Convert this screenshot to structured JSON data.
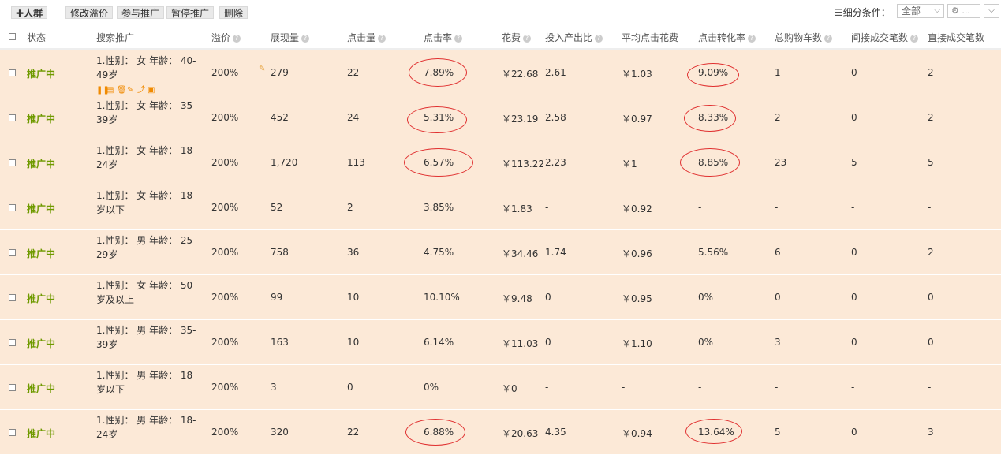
{
  "toolbar": {
    "add_label": "人群",
    "add_icon": "plus-icon",
    "buttons": [
      "修改溢价",
      "参与推广",
      "暂停推广",
      "删除"
    ],
    "filter_label": "细分条件：",
    "filter_value": "全部",
    "gear_text": "..."
  },
  "headers": {
    "status": "状态",
    "target": "搜索推广",
    "premium": "溢价",
    "impressions": "展现量",
    "clicks": "点击量",
    "ctr": "点击率",
    "cost": "花费",
    "roi": "投入产出比",
    "cpc": "平均点击花费",
    "cvr": "点击转化率",
    "cart": "总购物车数",
    "indirect": "间接成交笔数",
    "direct": "直接成交笔数"
  },
  "rows": [
    {
      "status": "推广中",
      "target": "1.性别： 女 年龄： 40-49岁",
      "premium": "200%",
      "impressions": "279",
      "clicks": "22",
      "ctr": "7.89%",
      "cost": "￥22.68",
      "roi": "2.61",
      "cpc": "￥1.03",
      "cvr": "9.09%",
      "cart": "1",
      "indirect": "0",
      "direct": "2"
    },
    {
      "status": "推广中",
      "target": "1.性别： 女 年龄： 35-39岁",
      "premium": "200%",
      "impressions": "452",
      "clicks": "24",
      "ctr": "5.31%",
      "cost": "￥23.19",
      "roi": "2.58",
      "cpc": "￥0.97",
      "cvr": "8.33%",
      "cart": "2",
      "indirect": "0",
      "direct": "2"
    },
    {
      "status": "推广中",
      "target": "1.性别： 女 年龄： 18-24岁",
      "premium": "200%",
      "impressions": "1,720",
      "clicks": "113",
      "ctr": "6.57%",
      "cost": "￥113.22",
      "roi": "2.23",
      "cpc": "￥1",
      "cvr": "8.85%",
      "cart": "23",
      "indirect": "5",
      "direct": "5"
    },
    {
      "status": "推广中",
      "target": "1.性别： 女 年龄： 18岁以下",
      "premium": "200%",
      "impressions": "52",
      "clicks": "2",
      "ctr": "3.85%",
      "cost": "￥1.83",
      "roi": "-",
      "cpc": "￥0.92",
      "cvr": "-",
      "cart": "-",
      "indirect": "-",
      "direct": "-"
    },
    {
      "status": "推广中",
      "target": "1.性别： 男 年龄： 25-29岁",
      "premium": "200%",
      "impressions": "758",
      "clicks": "36",
      "ctr": "4.75%",
      "cost": "￥34.46",
      "roi": "1.74",
      "cpc": "￥0.96",
      "cvr": "5.56%",
      "cart": "6",
      "indirect": "0",
      "direct": "2"
    },
    {
      "status": "推广中",
      "target": "1.性别： 女 年龄： 50岁及以上",
      "premium": "200%",
      "impressions": "99",
      "clicks": "10",
      "ctr": "10.10%",
      "cost": "￥9.48",
      "roi": "0",
      "cpc": "￥0.95",
      "cvr": "0%",
      "cart": "0",
      "indirect": "0",
      "direct": "0"
    },
    {
      "status": "推广中",
      "target": "1.性别： 男 年龄： 35-39岁",
      "premium": "200%",
      "impressions": "163",
      "clicks": "10",
      "ctr": "6.14%",
      "cost": "￥11.03",
      "roi": "0",
      "cpc": "￥1.10",
      "cvr": "0%",
      "cart": "3",
      "indirect": "0",
      "direct": "0"
    },
    {
      "status": "推广中",
      "target": "1.性别： 男 年龄： 18岁以下",
      "premium": "200%",
      "impressions": "3",
      "clicks": "0",
      "ctr": "0%",
      "cost": "￥0",
      "roi": "-",
      "cpc": "-",
      "cvr": "-",
      "cart": "-",
      "indirect": "-",
      "direct": "-"
    },
    {
      "status": "推广中",
      "target": "1.性别： 男 年龄： 18-24岁",
      "premium": "200%",
      "impressions": "320",
      "clicks": "22",
      "ctr": "6.88%",
      "cost": "￥20.63",
      "roi": "4.35",
      "cpc": "￥0.94",
      "cvr": "13.64%",
      "cart": "5",
      "indirect": "0",
      "direct": "3"
    }
  ],
  "colors": {
    "row_bg": "#fce9d7",
    "status": "#6f9a00",
    "highlight_circle": "#e03030"
  }
}
